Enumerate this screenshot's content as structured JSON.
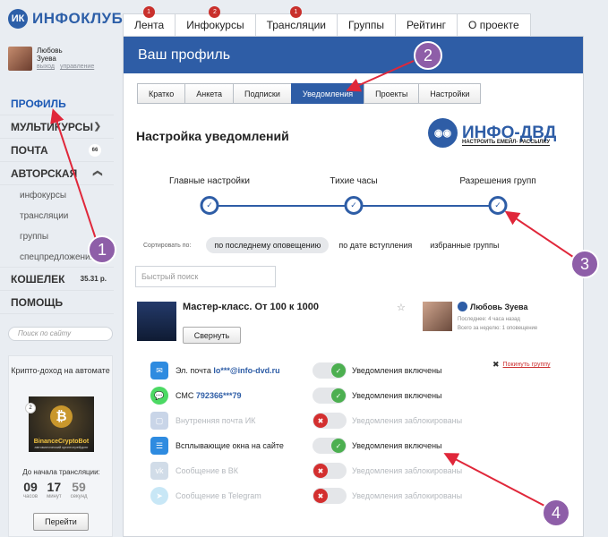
{
  "logo": {
    "text": "ИНФОКЛУБ",
    "mark": "ИК"
  },
  "user": {
    "first_name": "Любовь",
    "last_name": "Зуева",
    "logout": "выход",
    "manage": "управление"
  },
  "nav": {
    "profile": "ПРОФИЛЬ",
    "multicourses": "МУЛЬТИКУРСЫ",
    "mail": "ПОЧТА",
    "mail_badge": "66",
    "author": "АВТОРСКАЯ",
    "sub_items": [
      "инфокурсы",
      "трансляции",
      "группы",
      "спецпредложения"
    ],
    "wallet": "КОШЕЛЕК",
    "wallet_amount": "35.31 р.",
    "help": "ПОМОЩЬ"
  },
  "site_search": {
    "placeholder": "Поиск по сайту"
  },
  "promo": {
    "title": "Крипто-доход на автомате",
    "image_text": "BinanceCryptoBot",
    "image_sub": "автоматический криптотрейдинг",
    "slide_number": "2",
    "until_label": "До начала трансляции:",
    "timer": [
      {
        "value": "09",
        "unit": "часов"
      },
      {
        "value": "17",
        "unit": "минут"
      },
      {
        "value": "59",
        "unit": "секунд"
      }
    ],
    "button": "Перейти"
  },
  "top_tabs": [
    {
      "label": "Лента",
      "badge": "1"
    },
    {
      "label": "Инфокурсы",
      "badge": "2"
    },
    {
      "label": "Трансляции",
      "badge": "1"
    },
    {
      "label": "Группы",
      "badge": ""
    },
    {
      "label": "Рейтинг",
      "badge": ""
    },
    {
      "label": "О проекте",
      "badge": ""
    }
  ],
  "panel": {
    "title": "Ваш профиль"
  },
  "sub_tabs": [
    "Кратко",
    "Анкета",
    "Подписки",
    "Уведомления",
    "Проекты",
    "Настройки"
  ],
  "active_sub_tab": "Уведомления",
  "settings_title": "Настройка уведомлений",
  "brand": {
    "name": "ИНФО-ДВД",
    "tagline": "НАСТРОИТЬ ЕМЕЙЛ- РАССЫЛКУ"
  },
  "steps": [
    "Главные настройки",
    "Тихие часы",
    "Разрешения групп"
  ],
  "sort": {
    "label": "Сортировать по:",
    "options": [
      "по последнему оповещению",
      "по дате вступления",
      "избранные группы"
    ]
  },
  "quick_search": {
    "placeholder": "Быстрый поиск"
  },
  "group": {
    "title": "Мастер-класс. От 100 к 1000",
    "collapse": "Свернуть",
    "author_name": "Любовь Зуева",
    "last_label": "Последнее: 4 часа назад",
    "week_label": "Всего за неделю: 1 оповещение",
    "leave": "Покинуть группу"
  },
  "channels": [
    {
      "name": "Эл. почта",
      "value": "lo***@info-dvd.ru",
      "icon": "mail-icon",
      "color": "#2e8be0",
      "enabled": true,
      "status": "Уведомления включены"
    },
    {
      "name": "СМС",
      "value": "792366***79",
      "icon": "sms-icon",
      "color": "#4cd964",
      "enabled": true,
      "status": "Уведомления включены"
    },
    {
      "name": "Внутренняя почта ИК",
      "value": "",
      "icon": "inbox-icon",
      "color": "#2e5da6",
      "enabled": false,
      "status": "Уведомления заблокированы"
    },
    {
      "name": "Всплывающие окна на сайте",
      "value": "",
      "icon": "popup-icon",
      "color": "#2e8be0",
      "enabled": true,
      "status": "Уведомления включены"
    },
    {
      "name": "Сообщение в ВК",
      "value": "",
      "icon": "vk-icon",
      "color": "#4a76a8",
      "enabled": false,
      "status": "Уведомления заблокированы"
    },
    {
      "name": "Сообщение в Telegram",
      "value": "",
      "icon": "telegram-icon",
      "color": "#2aa3dd",
      "enabled": false,
      "status": "Уведомления заблокированы"
    }
  ],
  "callouts": [
    "1",
    "2",
    "3",
    "4"
  ],
  "colors": {
    "brand_blue": "#2e5da6",
    "callout": "#8e5ea8",
    "arrow": "#e0273a",
    "toggle_on": "#4caf50",
    "toggle_off": "#d32f2f"
  }
}
